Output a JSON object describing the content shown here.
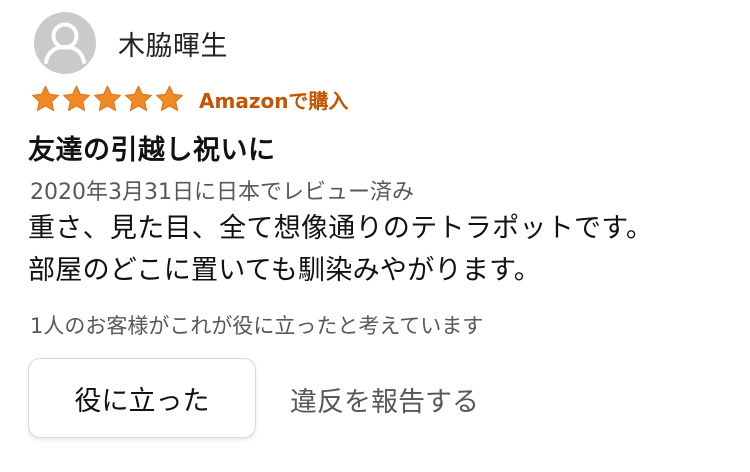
{
  "reviewer": {
    "name": "木脇暉生",
    "avatar_icon": "default-user-icon"
  },
  "rating": {
    "value": 5,
    "max": 5,
    "star_color": "#f08a24",
    "badge": "Amazonで購入",
    "badge_color": "#c45500"
  },
  "review": {
    "title": "友達の引越し祝いに",
    "date_line": "2020年3月31日に日本でレビュー済み",
    "body_lines": [
      "重さ、見た目、全て想像通りのテトラポットです。",
      "部屋のどこに置いても馴染みやがります。"
    ]
  },
  "helpful": {
    "count_text": "1人のお客様がこれが役に立ったと考えています",
    "button_label": "役に立った",
    "report_label": "違反を報告する"
  }
}
